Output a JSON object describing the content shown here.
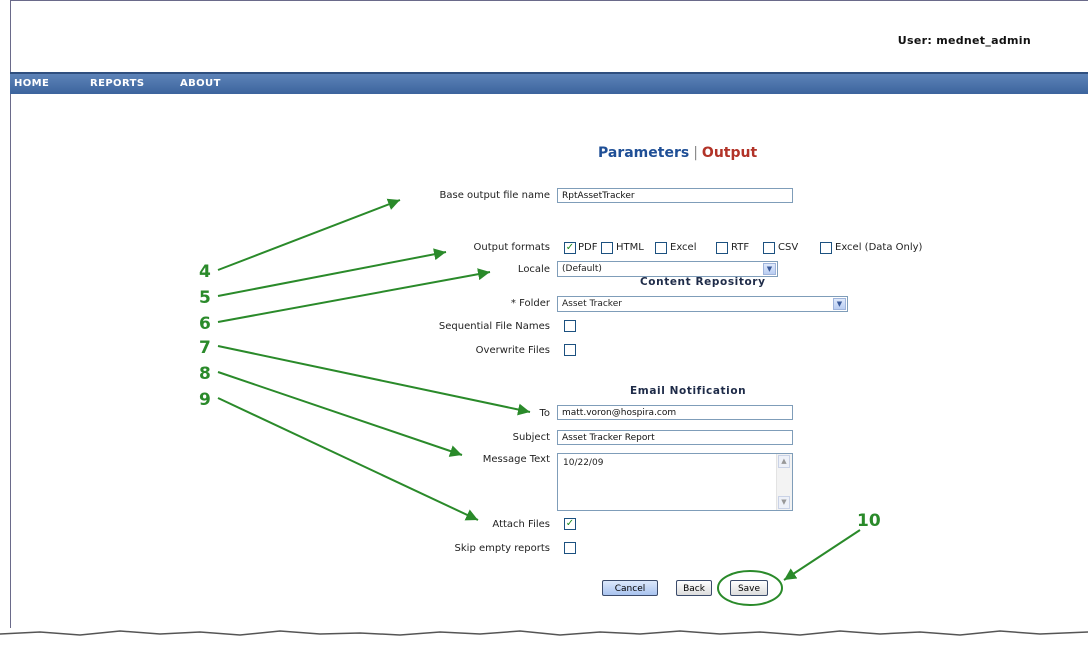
{
  "header": {
    "user_label": "User: mednet_admin"
  },
  "nav": {
    "items": [
      "HOME",
      "REPORTS",
      "ABOUT"
    ]
  },
  "tabs": {
    "parameters": "Parameters",
    "separator": "|",
    "output": "Output"
  },
  "form": {
    "base_output_label": "Base output file name",
    "base_output_value": "RptAssetTracker",
    "output_formats_label": "Output formats",
    "formats": [
      {
        "label": "PDF",
        "checked": true
      },
      {
        "label": "HTML",
        "checked": false
      },
      {
        "label": "Excel",
        "checked": false
      },
      {
        "label": "RTF",
        "checked": false
      },
      {
        "label": "CSV",
        "checked": false
      },
      {
        "label": "Excel (Data Only)",
        "checked": false
      }
    ],
    "locale_label": "Locale",
    "locale_value": "(Default)"
  },
  "content_repository": {
    "heading": "Content Repository",
    "folder_label": "* Folder",
    "folder_value": "Asset Tracker",
    "sequential_label": "Sequential File Names",
    "sequential_checked": false,
    "overwrite_label": "Overwrite Files",
    "overwrite_checked": false
  },
  "email": {
    "heading": "Email Notification",
    "to_label": "To",
    "to_value": "matt.voron@hospira.com",
    "subject_label": "Subject",
    "subject_value": "Asset Tracker Report",
    "message_label": "Message Text",
    "message_value": "10/22/09",
    "attach_label": "Attach Files",
    "attach_checked": true,
    "skip_label": "Skip empty reports",
    "skip_checked": false
  },
  "buttons": {
    "cancel": "Cancel",
    "back": "Back",
    "save": "Save"
  },
  "callouts": [
    "4",
    "5",
    "6",
    "7",
    "8",
    "9",
    "10"
  ],
  "colors": {
    "callout": "#2a8a2a",
    "nav": "#3c649d",
    "output_tab": "#b23328",
    "params_tab": "#1f4f96"
  }
}
